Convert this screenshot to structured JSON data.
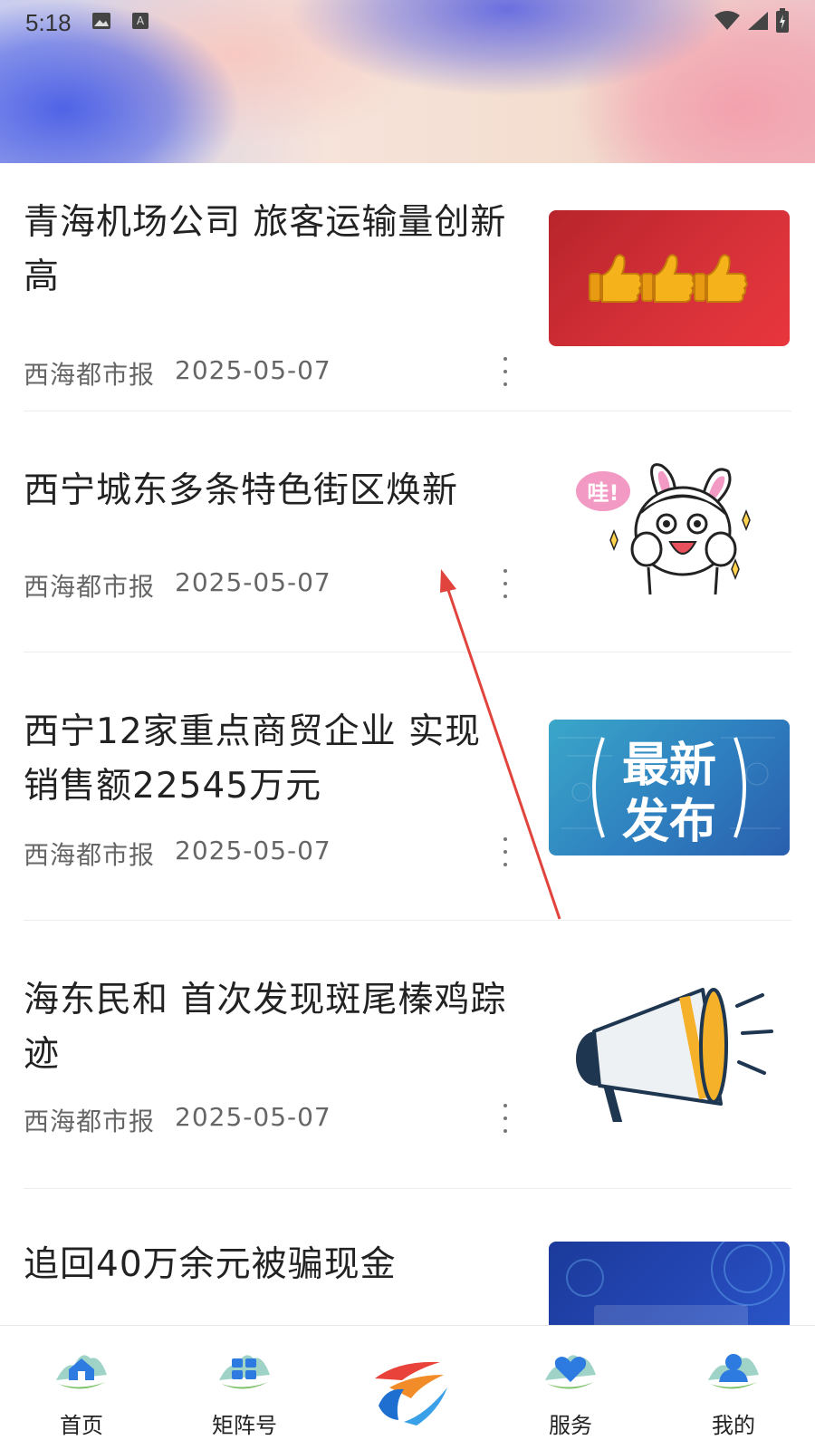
{
  "status_bar": {
    "time": "5:18",
    "icons": [
      "image-notification-icon",
      "keyboard-notification-icon",
      "wifi-icon",
      "signal-icon",
      "battery-icon"
    ]
  },
  "news": [
    {
      "title": "青海机场公司  旅客运输量创新高",
      "source": "西海都市报",
      "date": "2025-05-07",
      "thumb": "thumbs-up-thumbnail"
    },
    {
      "title": "西宁城东多条特色街区焕新",
      "source": "西海都市报",
      "date": "2025-05-07",
      "thumb": "cartoon-bunny-thumbnail",
      "thumb_text": "哇!"
    },
    {
      "title": "西宁12家重点商贸企业  实现销售额22545万元",
      "source": "西海都市报",
      "date": "2025-05-07",
      "thumb": "latest-release-thumbnail",
      "thumb_text_1": "最新",
      "thumb_text_2": "发布"
    },
    {
      "title": "海东民和  首次发现斑尾榛鸡踪迹",
      "source": "西海都市报",
      "date": "2025-05-07",
      "thumb": "megaphone-thumbnail"
    },
    {
      "title": "追回40万余元被骗现金",
      "source": "",
      "date": "",
      "thumb": "blue-banner-thumbnail"
    }
  ],
  "bottom_nav": [
    {
      "label": "首页",
      "icon": "home-icon"
    },
    {
      "label": "矩阵号",
      "icon": "matrix-icon"
    },
    {
      "label": "",
      "icon": "app-logo-icon"
    },
    {
      "label": "服务",
      "icon": "heart-service-icon"
    },
    {
      "label": "我的",
      "icon": "user-profile-icon"
    }
  ],
  "colors": {
    "accent_red": "#d93036",
    "nav_blue": "#1f6fd1",
    "arrow_red": "#e0443c"
  }
}
